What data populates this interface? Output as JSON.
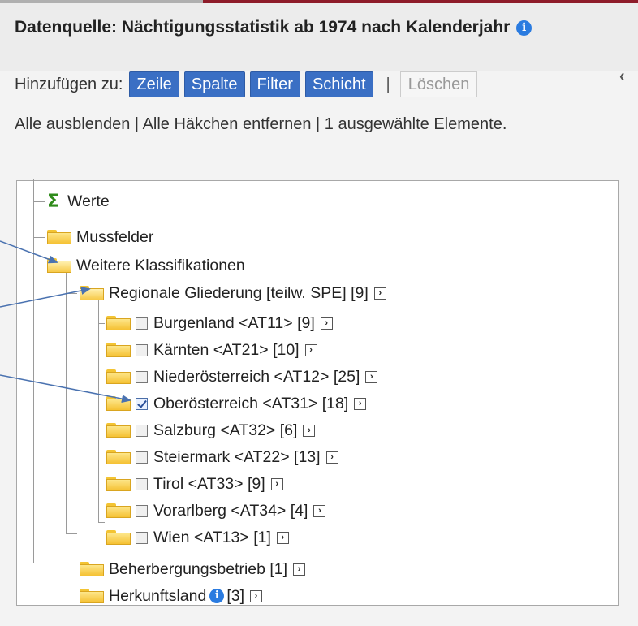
{
  "header": {
    "datasource": "Datenquelle: Nächtigungsstatistik ab 1974 nach Kalenderjahr"
  },
  "toolbar": {
    "add_label": "Hinzufügen zu:",
    "buttons": [
      "Zeile",
      "Spalte",
      "Filter",
      "Schicht"
    ],
    "separator": "|",
    "clear_label": "Löschen",
    "collapse_glyph": "‹"
  },
  "links": {
    "hide_all": "Alle ausblenden",
    "sep1": " | ",
    "uncheck_all": "Alle Häkchen entfernen",
    "sep2": " | ",
    "selected_count": "1 ausgewählte Elemente."
  },
  "tree": {
    "werte": "Werte",
    "mussfelder": "Mussfelder",
    "weitere": "Weitere Klassifikationen",
    "regional": "Regionale Gliederung [teilw. SPE] [9]",
    "regions": [
      {
        "label": "Burgenland <AT11> [9]",
        "checked": false
      },
      {
        "label": "Kärnten <AT21> [10]",
        "checked": false
      },
      {
        "label": "Niederösterreich <AT12> [25]",
        "checked": false
      },
      {
        "label": "Oberösterreich <AT31> [18]",
        "checked": true
      },
      {
        "label": "Salzburg <AT32> [6]",
        "checked": false
      },
      {
        "label": "Steiermark <AT22> [13]",
        "checked": false
      },
      {
        "label": "Tirol <AT33> [9]",
        "checked": false
      },
      {
        "label": "Vorarlberg <AT34> [4]",
        "checked": false
      },
      {
        "label": "Wien <AT13> [1]",
        "checked": false
      }
    ],
    "betrieb": "Beherbergungsbetrieb [1]",
    "herkunft_label": "Herkunftsland",
    "herkunft_count": "[3]"
  },
  "colors": {
    "button_blue": "#3a6fc4",
    "folder_yellow": "#f5c133",
    "arrow_blue": "#4a72b0",
    "accent_red": "#8e1c2a"
  }
}
